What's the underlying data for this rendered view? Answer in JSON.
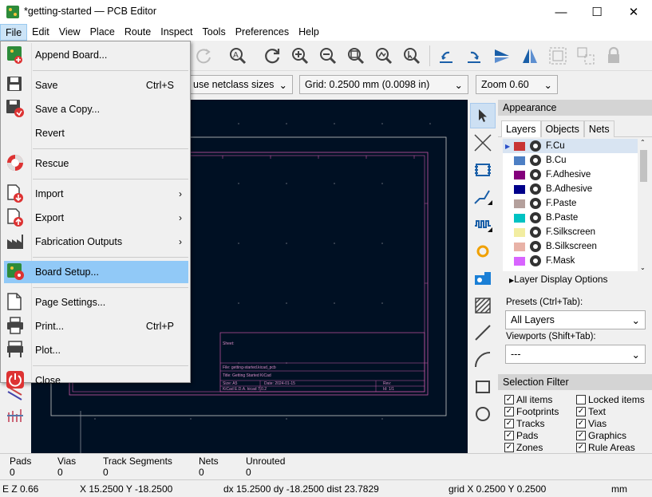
{
  "window": {
    "title": "*getting-started — PCB Editor",
    "minimize": "—",
    "maximize": "☐",
    "close": "✕"
  },
  "menubar": [
    "File",
    "Edit",
    "View",
    "Place",
    "Route",
    "Inspect",
    "Tools",
    "Preferences",
    "Help"
  ],
  "toolbar2": {
    "track_width": "use netclass sizes",
    "grid": "Grid: 0.2500 mm (0.0098 in)",
    "zoom": "Zoom 0.60"
  },
  "file_menu": [
    {
      "label": "Append Board...",
      "shortcut": "",
      "submenu": false,
      "icon": "append-board-icon"
    },
    {
      "sep": true
    },
    {
      "label": "Save",
      "shortcut": "Ctrl+S",
      "submenu": false,
      "icon": "save-icon"
    },
    {
      "label": "Save a Copy...",
      "shortcut": "",
      "submenu": false,
      "icon": "save-copy-icon"
    },
    {
      "label": "Revert",
      "shortcut": "",
      "submenu": false,
      "icon": ""
    },
    {
      "sep": true
    },
    {
      "label": "Rescue",
      "shortcut": "",
      "submenu": false,
      "icon": "rescue-icon"
    },
    {
      "sep": true
    },
    {
      "label": "Import",
      "shortcut": "",
      "submenu": true,
      "icon": "import-icon"
    },
    {
      "label": "Export",
      "shortcut": "",
      "submenu": true,
      "icon": "export-icon"
    },
    {
      "label": "Fabrication Outputs",
      "shortcut": "",
      "submenu": true,
      "icon": "fabrication-icon"
    },
    {
      "sep": true
    },
    {
      "label": "Board Setup...",
      "shortcut": "",
      "submenu": false,
      "icon": "board-setup-icon",
      "highlight": true
    },
    {
      "sep": true
    },
    {
      "label": "Page Settings...",
      "shortcut": "",
      "submenu": false,
      "icon": "page-settings-icon"
    },
    {
      "label": "Print...",
      "shortcut": "Ctrl+P",
      "submenu": false,
      "icon": "print-icon"
    },
    {
      "label": "Plot...",
      "shortcut": "",
      "submenu": false,
      "icon": "plot-icon"
    },
    {
      "sep": true
    },
    {
      "label": "Close",
      "shortcut": "",
      "submenu": false,
      "icon": "power-icon"
    }
  ],
  "appearance": {
    "title": "Appearance",
    "tabs": [
      "Layers",
      "Objects",
      "Nets"
    ],
    "layers": [
      {
        "name": "F.Cu",
        "color": "#c83434"
      },
      {
        "name": "B.Cu",
        "color": "#4d7fc4"
      },
      {
        "name": "F.Adhesive",
        "color": "#84007c"
      },
      {
        "name": "B.Adhesive",
        "color": "#00008a"
      },
      {
        "name": "F.Paste",
        "color": "#b4a09c"
      },
      {
        "name": "B.Paste",
        "color": "#00c2c2"
      },
      {
        "name": "F.Silkscreen",
        "color": "#f2eda1"
      },
      {
        "name": "B.Silkscreen",
        "color": "#e8b2a7"
      },
      {
        "name": "F.Mask",
        "color": "#d864ff"
      }
    ],
    "layer_display_options": "Layer Display Options",
    "presets_label": "Presets (Ctrl+Tab):",
    "presets_value": "All Layers",
    "viewports_label": "Viewports (Shift+Tab):",
    "viewports_value": "---"
  },
  "selection_filter": {
    "title": "Selection Filter",
    "items": [
      {
        "label": "All items",
        "checked": true
      },
      {
        "label": "Locked items",
        "checked": false
      },
      {
        "label": "Footprints",
        "checked": true
      },
      {
        "label": "Text",
        "checked": true
      },
      {
        "label": "Tracks",
        "checked": true
      },
      {
        "label": "Vias",
        "checked": true
      },
      {
        "label": "Pads",
        "checked": true
      },
      {
        "label": "Graphics",
        "checked": true
      },
      {
        "label": "Zones",
        "checked": true
      },
      {
        "label": "Rule Areas",
        "checked": true
      }
    ]
  },
  "stats": [
    {
      "label": "Pads",
      "value": "0"
    },
    {
      "label": "Vias",
      "value": "0"
    },
    {
      "label": "Track Segments",
      "value": "0"
    },
    {
      "label": "Nets",
      "value": "0"
    },
    {
      "label": "Unrouted",
      "value": "0"
    }
  ],
  "status": {
    "zoom": "E  Z 0.66",
    "xy": "X 15.2500  Y -18.2500",
    "delta": "dx 15.2500  dy -18.2500  dist 23.7829",
    "grid": "grid X 0.2500  Y 0.2500",
    "units": "mm"
  },
  "title_block": {
    "sheet": "Sheet:",
    "file": "File: getting-started.kicad_pcb",
    "title": "Title: Getting Started KiCad",
    "size": "Size: A5",
    "date": "Date: 2024-01-15",
    "rev": "Rev:",
    "kicad": "KiCad E.D.A.  kicad 7.0.2",
    "id": "Id: 1/1"
  }
}
